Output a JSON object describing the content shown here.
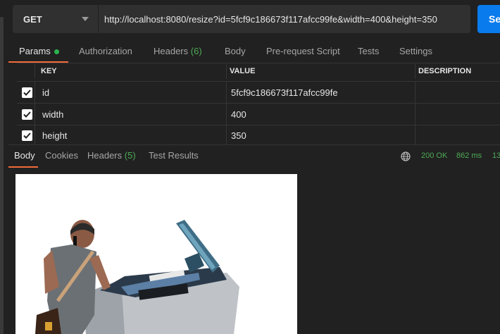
{
  "request": {
    "method": "GET",
    "url": "http://localhost:8080/resize?id=5fcf9c186673f117afcc99fe&width=400&height=350",
    "send_label": "Se"
  },
  "request_tabs": [
    {
      "label": "Params",
      "active": true,
      "dot": true
    },
    {
      "label": "Authorization"
    },
    {
      "label": "Headers",
      "count": "(6)"
    },
    {
      "label": "Body"
    },
    {
      "label": "Pre-request Script"
    },
    {
      "label": "Tests"
    },
    {
      "label": "Settings"
    }
  ],
  "params_table": {
    "columns": [
      "KEY",
      "VALUE",
      "DESCRIPTION"
    ],
    "rows": [
      {
        "checked": true,
        "key": "id",
        "value": "5fcf9c186673f117afcc99fe",
        "description": ""
      },
      {
        "checked": true,
        "key": "width",
        "value": "400",
        "description": ""
      },
      {
        "checked": true,
        "key": "height",
        "value": "350",
        "description": ""
      }
    ]
  },
  "response_tabs": [
    {
      "label": "Body",
      "active": true
    },
    {
      "label": "Cookies"
    },
    {
      "label": "Headers",
      "count": "(5)"
    },
    {
      "label": "Test Results"
    }
  ],
  "response_status": {
    "status": "200 OK",
    "time": "862 ms",
    "size": "13"
  },
  "icons": {
    "network": "globe-icon",
    "checkbox": "checkmark-icon",
    "method_dropdown": "chevron-down-icon"
  },
  "colors": {
    "accent": "#f26b3a",
    "send": "#097bed",
    "success": "#4dab56",
    "background": "#212121"
  }
}
